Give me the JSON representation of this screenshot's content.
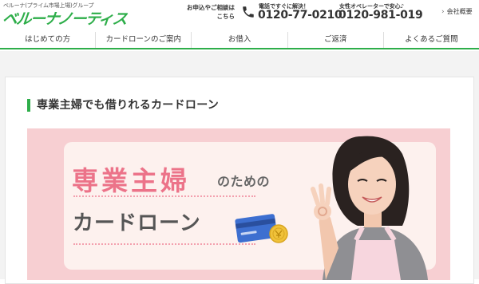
{
  "header": {
    "group_text": "ベルーナ(プライム市場上場)グループ",
    "logo_text": "ベルーナノーティス",
    "contact_label_line1": "お申込やご相談は",
    "contact_label_line2": "こちら",
    "phone1_caption": "電話ですぐに解決！",
    "phone1_number": "0120-77-0210",
    "phone2_caption": "女性オペレーターで安心♪",
    "phone2_number": "0120-981-019",
    "company_link": "会社概要"
  },
  "nav": {
    "items": [
      {
        "label": "はじめての方"
      },
      {
        "label": "カードローンのご案内"
      },
      {
        "label": "お借入"
      },
      {
        "label": "ご返済"
      },
      {
        "label": "よくあるご質問"
      }
    ]
  },
  "main": {
    "page_title": "専業主婦でも借りれるカードローン",
    "banner": {
      "main_text": "専業主婦",
      "suffix_text": "のための",
      "sub_text": "カードローン"
    }
  },
  "colors": {
    "brand_green": "#2eae4a",
    "banner_pink": "#ec7389",
    "banner_bg": "#f7cfd2"
  },
  "icons": {
    "phone": "phone-icon",
    "chevron": "chevron-right-icon",
    "card": "credit-card-icon",
    "sparkle": "sparkle-icon"
  }
}
